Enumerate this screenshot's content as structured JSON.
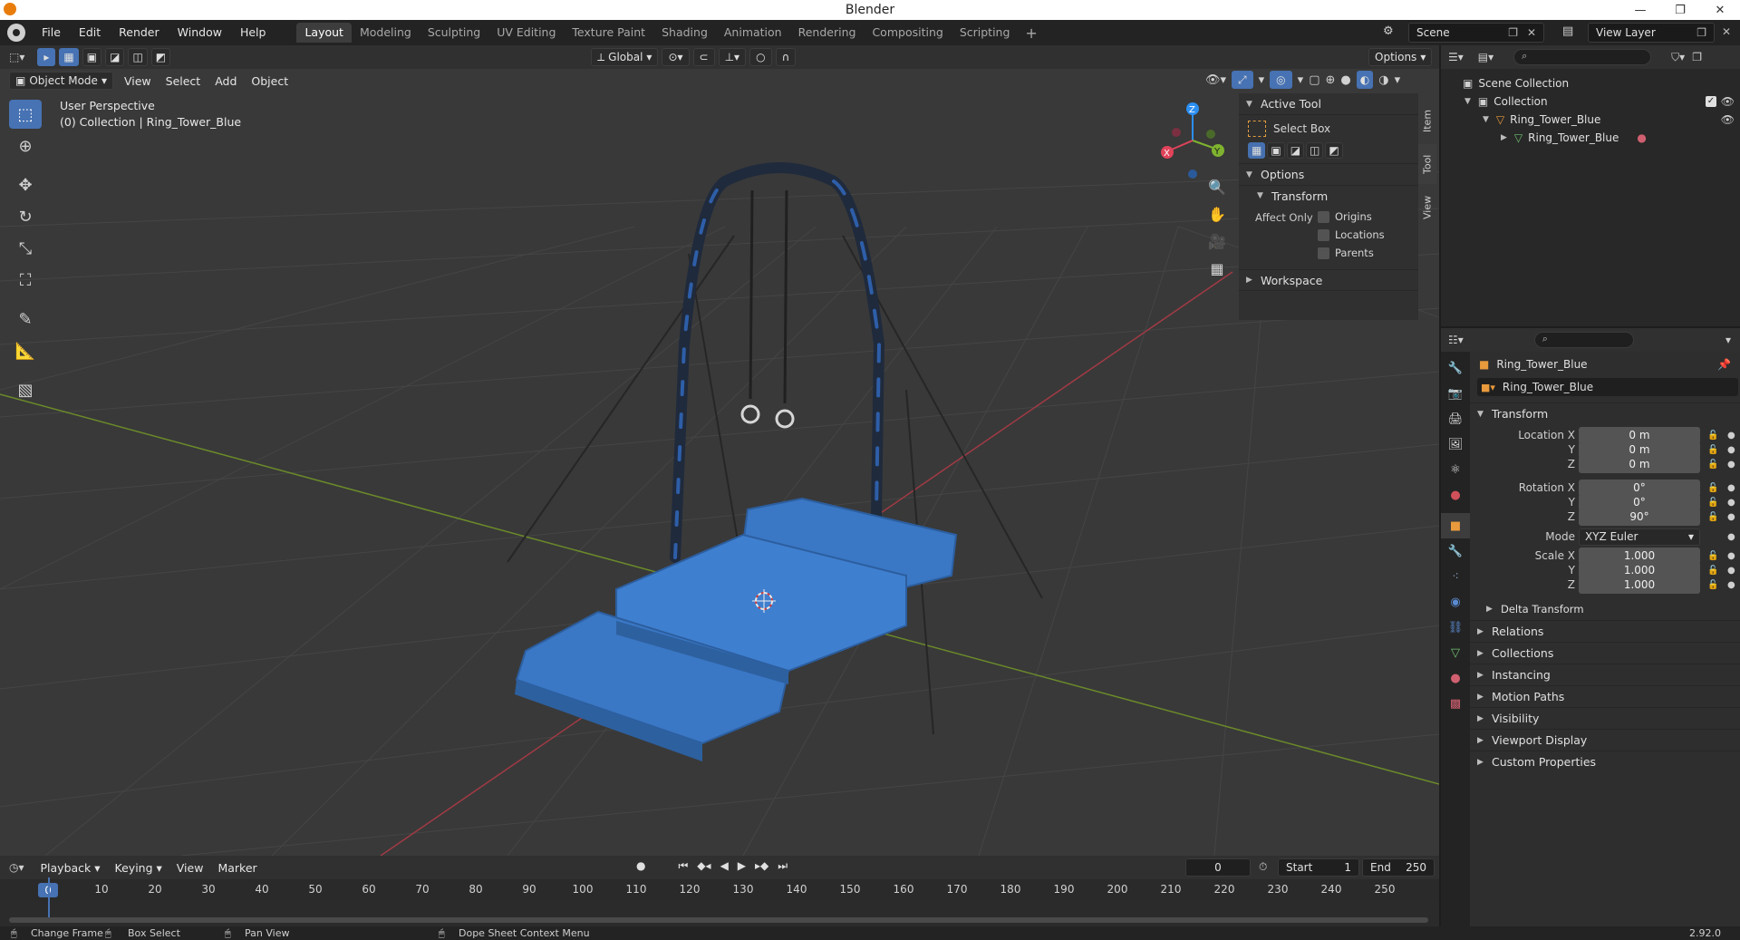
{
  "window": {
    "title": "Blender",
    "controls": [
      "—",
      "❐",
      "✕"
    ]
  },
  "menu": [
    "File",
    "Edit",
    "Render",
    "Window",
    "Help"
  ],
  "workspaces": [
    "Layout",
    "Modeling",
    "Sculpting",
    "UV Editing",
    "Texture Paint",
    "Shading",
    "Animation",
    "Rendering",
    "Compositing",
    "Scripting"
  ],
  "active_workspace": "Layout",
  "scene": {
    "name": "Scene",
    "view_layer": "View Layer"
  },
  "viewport": {
    "mode": "Object Mode",
    "menus": [
      "View",
      "Select",
      "Add",
      "Object"
    ],
    "orientation": "Global",
    "options_label": "Options",
    "perspective_label": "User Perspective",
    "collection_label": "(0) Collection | Ring_Tower_Blue",
    "gizmo_axes": {
      "x": "X",
      "y": "Y",
      "z": "Z"
    }
  },
  "npanel": {
    "tabs": [
      "Item",
      "Tool",
      "View"
    ],
    "active_tab": "Tool",
    "active_tool_header": "Active Tool",
    "active_tool_name": "Select Box",
    "options_header": "Options",
    "transform_header": "Transform",
    "affect_only_label": "Affect Only",
    "affect_only": [
      "Origins",
      "Locations",
      "Parents"
    ],
    "workspace_header": "Workspace"
  },
  "timeline": {
    "menus": [
      "Playback",
      "Keying",
      "View",
      "Marker"
    ],
    "current_frame": "0",
    "start_label": "Start",
    "start": "1",
    "end_label": "End",
    "end": "250",
    "ticks": [
      "0",
      "10",
      "20",
      "30",
      "40",
      "50",
      "60",
      "70",
      "80",
      "90",
      "100",
      "110",
      "120",
      "130",
      "140",
      "150",
      "160",
      "170",
      "180",
      "190",
      "200",
      "210",
      "220",
      "230",
      "240",
      "250"
    ]
  },
  "statusbar": {
    "items": [
      "Change Frame",
      "Box Select",
      "Pan View",
      "Dope Sheet Context Menu"
    ],
    "version": "2.92.0"
  },
  "outliner": {
    "rows": [
      {
        "label": "Scene Collection",
        "indent": 0
      },
      {
        "label": "Collection",
        "indent": 1
      },
      {
        "label": "Ring_Tower_Blue",
        "indent": 2
      },
      {
        "label": "Ring_Tower_Blue",
        "indent": 3
      }
    ]
  },
  "properties": {
    "object_name": "Ring_Tower_Blue",
    "datablock_name": "Ring_Tower_Blue",
    "transform_header": "Transform",
    "location_label": "Location X",
    "rotation_label": "Rotation X",
    "scale_label": "Scale X",
    "axis_y": "Y",
    "axis_z": "Z",
    "location": [
      "0 m",
      "0 m",
      "0 m"
    ],
    "rotation": [
      "0°",
      "0°",
      "90°"
    ],
    "mode_label": "Mode",
    "mode_value": "XYZ Euler",
    "scale": [
      "1.000",
      "1.000",
      "1.000"
    ],
    "delta_transform": "Delta Transform",
    "sections": [
      "Relations",
      "Collections",
      "Instancing",
      "Motion Paths",
      "Visibility",
      "Viewport Display",
      "Custom Properties"
    ]
  },
  "colors": {
    "accent": "#4772b3",
    "mat_blue": "#3a77c4",
    "x_axis": "#e0435a",
    "y_axis": "#7fb32f",
    "z_axis": "#2c8ff2"
  }
}
